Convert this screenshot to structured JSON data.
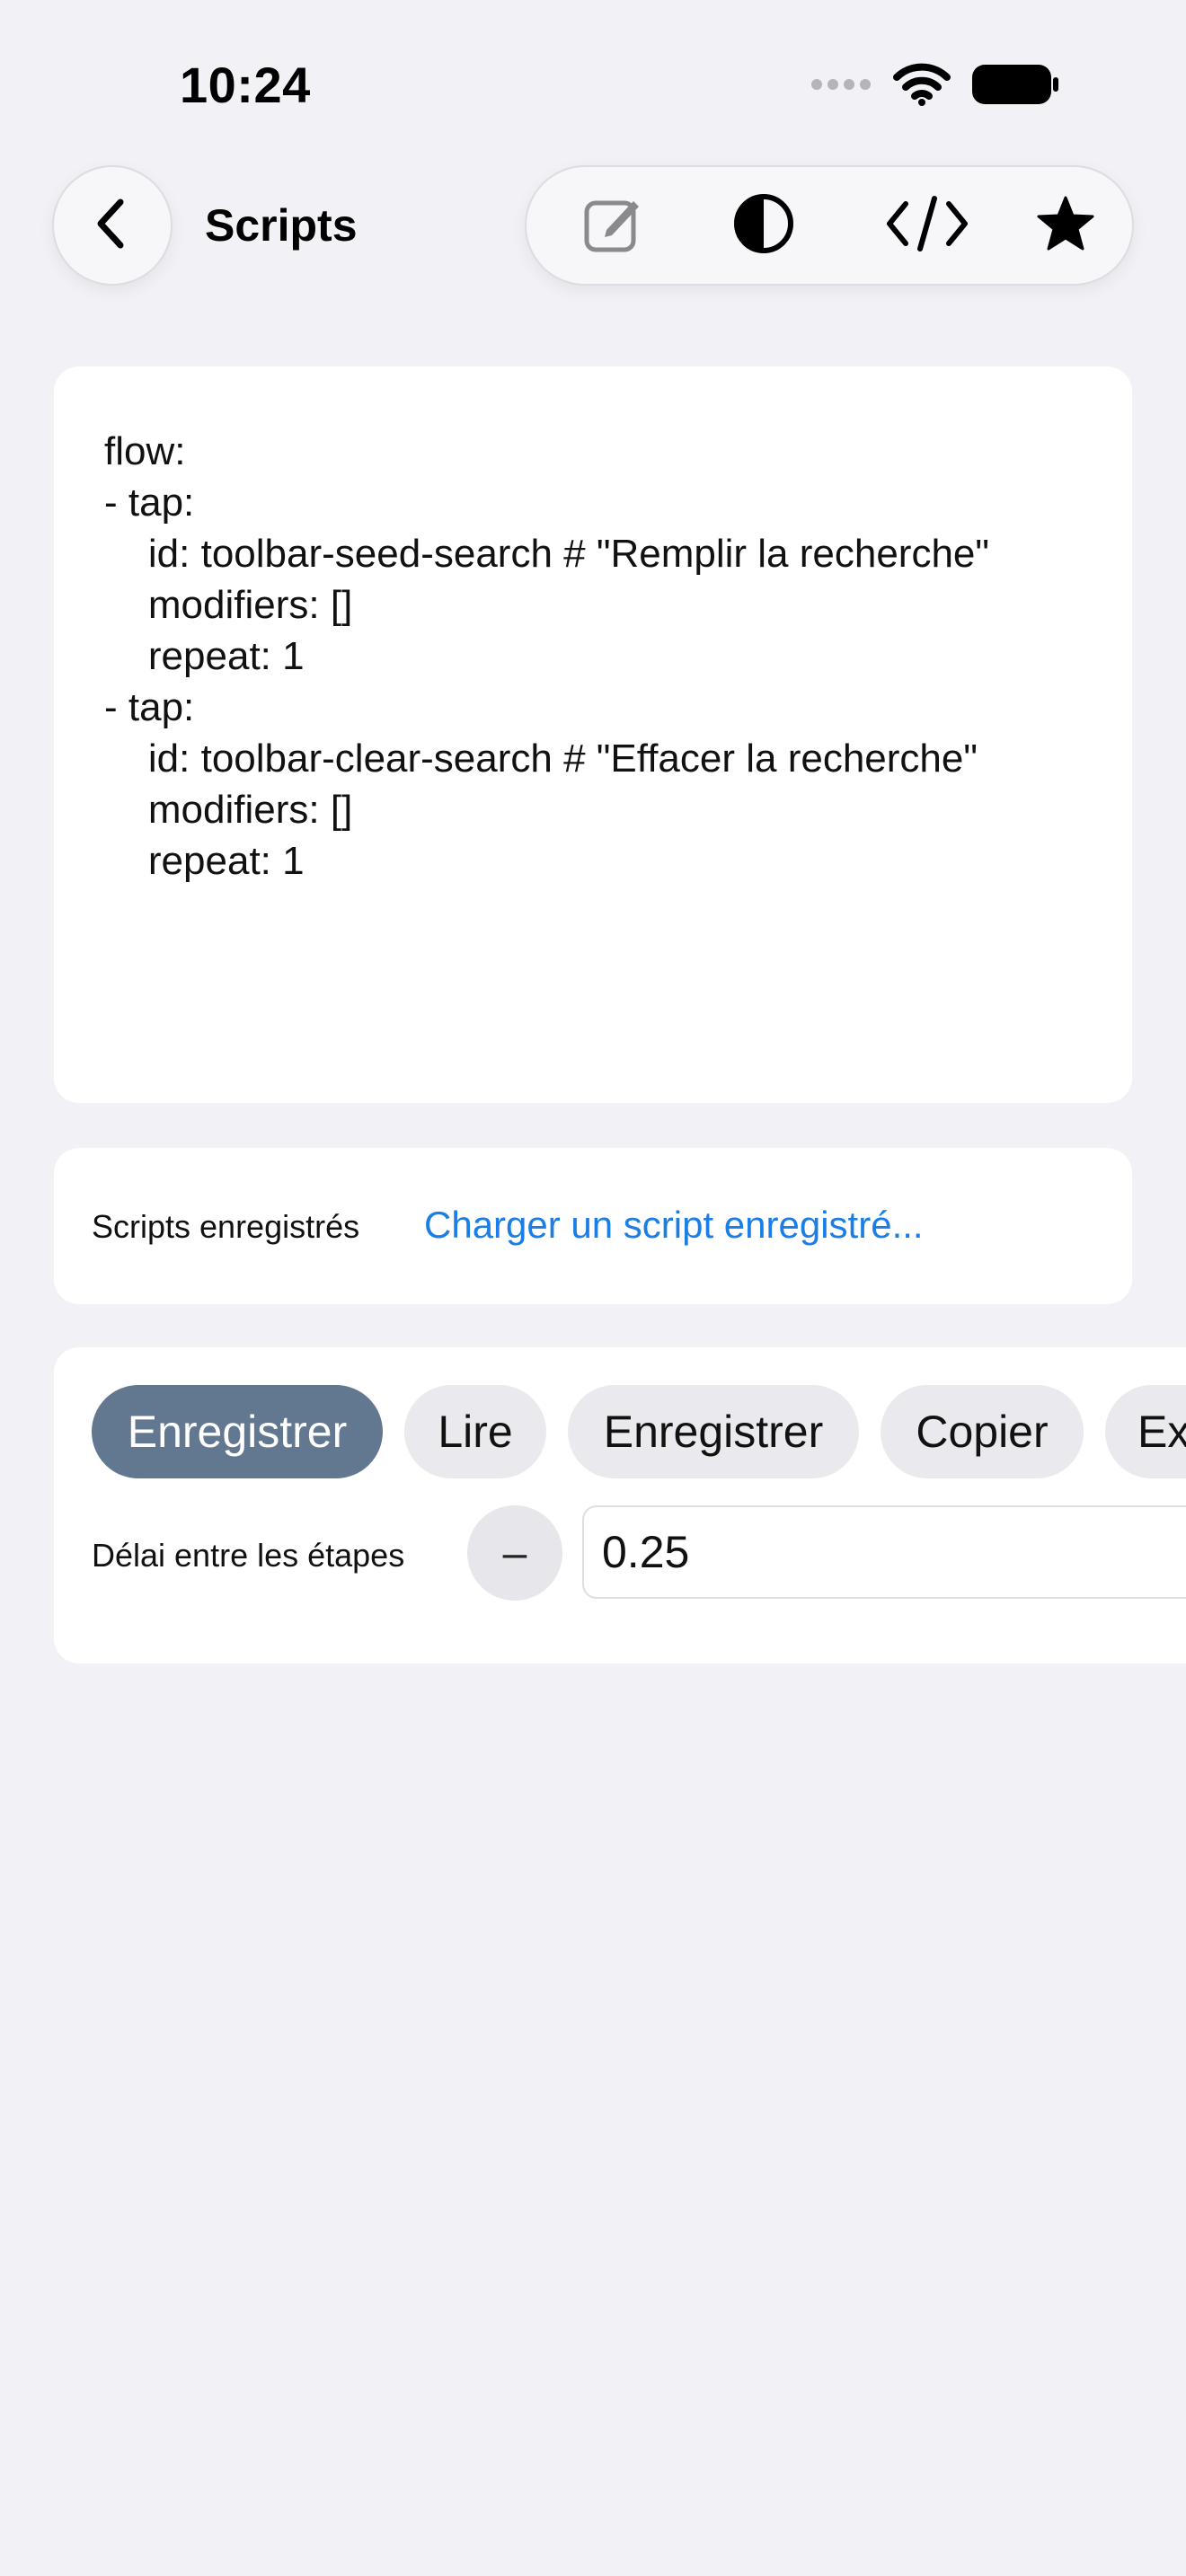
{
  "status_bar": {
    "time": "10:24",
    "icons": [
      "cellular-dots-icon",
      "wifi-icon",
      "battery-icon"
    ]
  },
  "nav": {
    "title": "Scripts",
    "back_icon": "chevron-left-icon",
    "toolbar_icons": [
      "edit-icon",
      "contrast-icon",
      "code-icon",
      "star-icon"
    ]
  },
  "script_editor": {
    "content": "flow:\n- tap:\n    id: toolbar-seed-search # \"Remplir la recherche\"\n    modifiers: []\n    repeat: 1\n- tap:\n    id: toolbar-clear-search # \"Effacer la recherche\"\n    modifiers: []\n    repeat: 1"
  },
  "saved_scripts": {
    "label": "Scripts enregistrés",
    "link": "Charger un script enregistré..."
  },
  "actions": {
    "buttons": [
      "Enregistrer",
      "Lire",
      "Enregistrer",
      "Copier",
      "Ex"
    ],
    "delay_label": "Délai entre les étapes",
    "stepper_minus": "–",
    "delay_value": "0.25"
  },
  "colors": {
    "background": "#f1f1f6",
    "accent_link": "#1a7ee6",
    "primary_button": "#627790"
  }
}
